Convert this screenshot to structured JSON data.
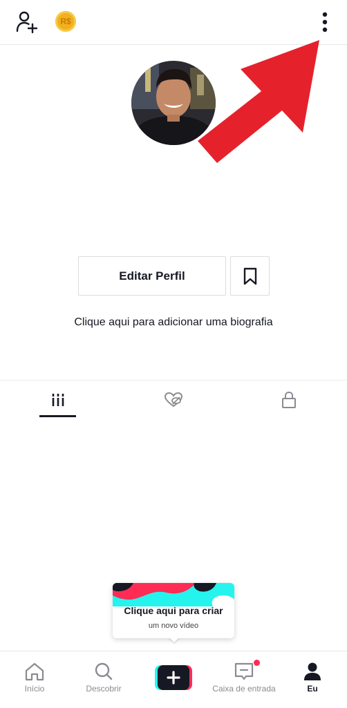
{
  "top_bar": {
    "add_user_icon": "person-add-icon",
    "coin_label": "R$",
    "more_icon": "vertical-dots-icon"
  },
  "profile": {
    "avatar_icon": "profile-photo",
    "edit_profile_label": "Editar Perfil",
    "bookmark_icon": "bookmark-icon",
    "bio_prompt": "Clique aqui para adicionar uma biografia"
  },
  "tabs": [
    {
      "icon": "videos-grid-icon",
      "active": true
    },
    {
      "icon": "liked-hidden-icon",
      "active": false
    },
    {
      "icon": "lock-icon",
      "active": false
    }
  ],
  "tooltip": {
    "title": "Clique aqui para criar",
    "subtitle": "um novo vídeo"
  },
  "bottom_nav": {
    "home": "Início",
    "discover": "Descobrir",
    "inbox": "Caixa de entrada",
    "me": "Eu"
  },
  "colors": {
    "arrow": "#e5222c",
    "accent_pink": "#fe2c55",
    "accent_cyan": "#25f4ee",
    "text": "#161823"
  }
}
